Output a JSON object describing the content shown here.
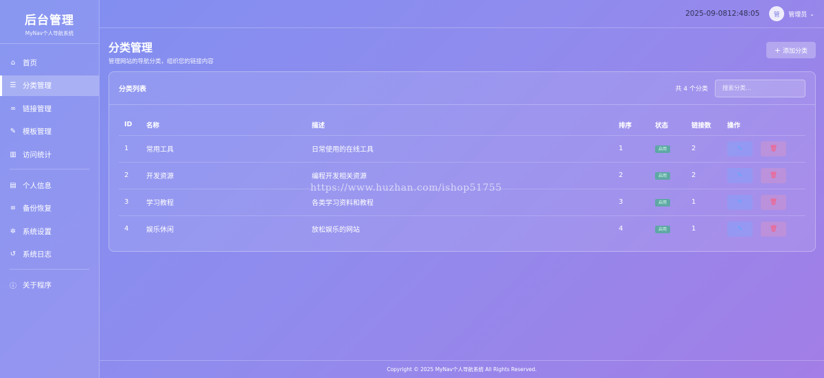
{
  "sidebar": {
    "title": "后台管理",
    "subtitle": "MyNav个人导航系统",
    "items": [
      {
        "label": "首页",
        "icon": "home-icon",
        "glyph": "⌂"
      },
      {
        "label": "分类管理",
        "icon": "list-icon",
        "glyph": "☰"
      },
      {
        "label": "链接管理",
        "icon": "link-icon",
        "glyph": "∞"
      },
      {
        "label": "模板管理",
        "icon": "brush-icon",
        "glyph": "✎"
      },
      {
        "label": "访问统计",
        "icon": "chart-icon",
        "glyph": "▥"
      },
      {
        "label": "个人信息",
        "icon": "id-card-icon",
        "glyph": "▤"
      },
      {
        "label": "备份恢复",
        "icon": "database-icon",
        "glyph": "≡"
      },
      {
        "label": "系统设置",
        "icon": "gear-icon",
        "glyph": "✲"
      },
      {
        "label": "系统日志",
        "icon": "history-icon",
        "glyph": "↺"
      },
      {
        "label": "关于程序",
        "icon": "info-icon",
        "glyph": "ⓘ"
      }
    ],
    "active_index": 1
  },
  "topbar": {
    "datetime": "2025-09-0812:48:05",
    "avatar_text": "管",
    "user_name": "管理员",
    "caret": "⌄"
  },
  "page": {
    "title": "分类管理",
    "description": "管理网站的导航分类，组织您的链接内容",
    "add_button": "添加分类",
    "add_glyph": "+"
  },
  "list": {
    "title": "分类列表",
    "count_text": "共 4 个分类",
    "search_placeholder": "搜索分类...",
    "columns": [
      "ID",
      "名称",
      "描述",
      "排序",
      "状态",
      "链接数",
      "操作"
    ],
    "rows": [
      {
        "id": "1",
        "name": "常用工具",
        "desc": "日常使用的在线工具",
        "sort": "1",
        "status": "启用",
        "links": "2"
      },
      {
        "id": "2",
        "name": "开发资源",
        "desc": "编程开发相关资源",
        "sort": "2",
        "status": "启用",
        "links": "2"
      },
      {
        "id": "3",
        "name": "学习教程",
        "desc": "各类学习资料和教程",
        "sort": "3",
        "status": "启用",
        "links": "1"
      },
      {
        "id": "4",
        "name": "娱乐休闲",
        "desc": "放松娱乐的网站",
        "sort": "4",
        "status": "启用",
        "links": "1"
      }
    ],
    "edit_glyph": "✎",
    "delete_glyph": "🗑"
  },
  "watermark": "https://www.huzhan.com/ishop51755",
  "footer": "Copyright © 2025 MyNav个人导航系统 All Rights Reserved.",
  "colors": {
    "edit": "#5ea8ff",
    "delete": "#ff5a7a",
    "status": "#28b96e"
  }
}
